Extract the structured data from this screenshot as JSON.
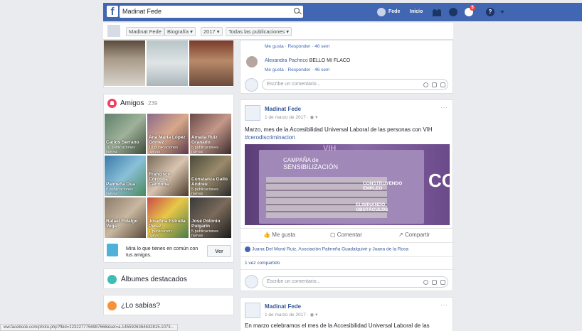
{
  "topbar": {
    "logo": "f",
    "search_value": "Madinat Fede",
    "nav_user": "Fede",
    "nav_home": "Inicio",
    "notif_count": "5",
    "help": "?"
  },
  "subnav": {
    "profile": "Madinat Fede",
    "section": "Biografía",
    "year": "2017",
    "filter": "Todas las publicaciones"
  },
  "friends": {
    "title": "Amigos",
    "count": "239",
    "items": [
      {
        "name": "Carlos Serrano",
        "pubs": "10 publicaciones",
        "new": "nuevas"
      },
      {
        "name": "Ana María López Gómez",
        "pubs": "10 publicaciones",
        "new": "nuevas"
      },
      {
        "name": "Amalia Ruiz Granado",
        "pubs": "5 publicaciones",
        "new": "nuevas"
      },
      {
        "name": "Palmeña Dua",
        "pubs": "8 publicaciones",
        "new": "nuevas"
      },
      {
        "name": "Francisco Córdoba Carmona",
        "pubs": "",
        "new": ""
      },
      {
        "name": "Constanza Gallo Andreu",
        "pubs": "5 publicaciones",
        "new": "nuevas"
      },
      {
        "name": "Rafael Fidalgo Vega",
        "pubs": "",
        "new": ""
      },
      {
        "name": "Josefina Estrella Pérez",
        "pubs": "1 publicación",
        "new": "nueva"
      },
      {
        "name": "José Polonio Pulgarín",
        "pubs": "5 publicaciones",
        "new": "nuevas"
      }
    ],
    "suggest_text": "Mira lo que tienes en común con tus amigos.",
    "ver_button": "Ver"
  },
  "albums_label": "Álbumes destacados",
  "sabias_label": "¿Lo sabías?",
  "post1": {
    "links_top": "Me gusta · Responder · 46 sem",
    "commenter": "Alexandra Pacheco",
    "comment": "BELLO MI FLACO",
    "links_bottom": "Me gusta · Responder · 46 sem",
    "write_placeholder": "Escribe un comentario..."
  },
  "post2": {
    "author": "Madinat Fede",
    "date": "1 de marzo de 2017 · ",
    "text": "Marzo, mes de la Accesibilidad Universal Laboral de las personas con VIH",
    "hashtag": "#cerodiscriminacion",
    "image_text": {
      "t1": "VIH",
      "t2": "CAMPAÑA de",
      "t3": "SENSIBILIZACIÓN",
      "t4": "CONSTRUYENDO EMPLEO",
      "t5": "ELIMINANDO OBSTÁCULOS",
      "t6": "CO"
    },
    "like": "Me gusta",
    "comment": "Comentar",
    "share": "Compartir",
    "likers": "Juana Del Moral Ruiz, Asociación Palmeña Guadalquivir y Juana de la Rosa",
    "shares": "1 vez compartido",
    "write_placeholder": "Escribe un comentario..."
  },
  "post3": {
    "author": "Madinat Fede",
    "date": "1 de marzo de 2017 · ",
    "text": "En marzo celebramos el mes de la Accesibilidad Universal Laboral de las"
  },
  "status_url": "ww.facebook.com/photo.php?fbid=2232277756987666&set=a.1455926364632815.1073..."
}
